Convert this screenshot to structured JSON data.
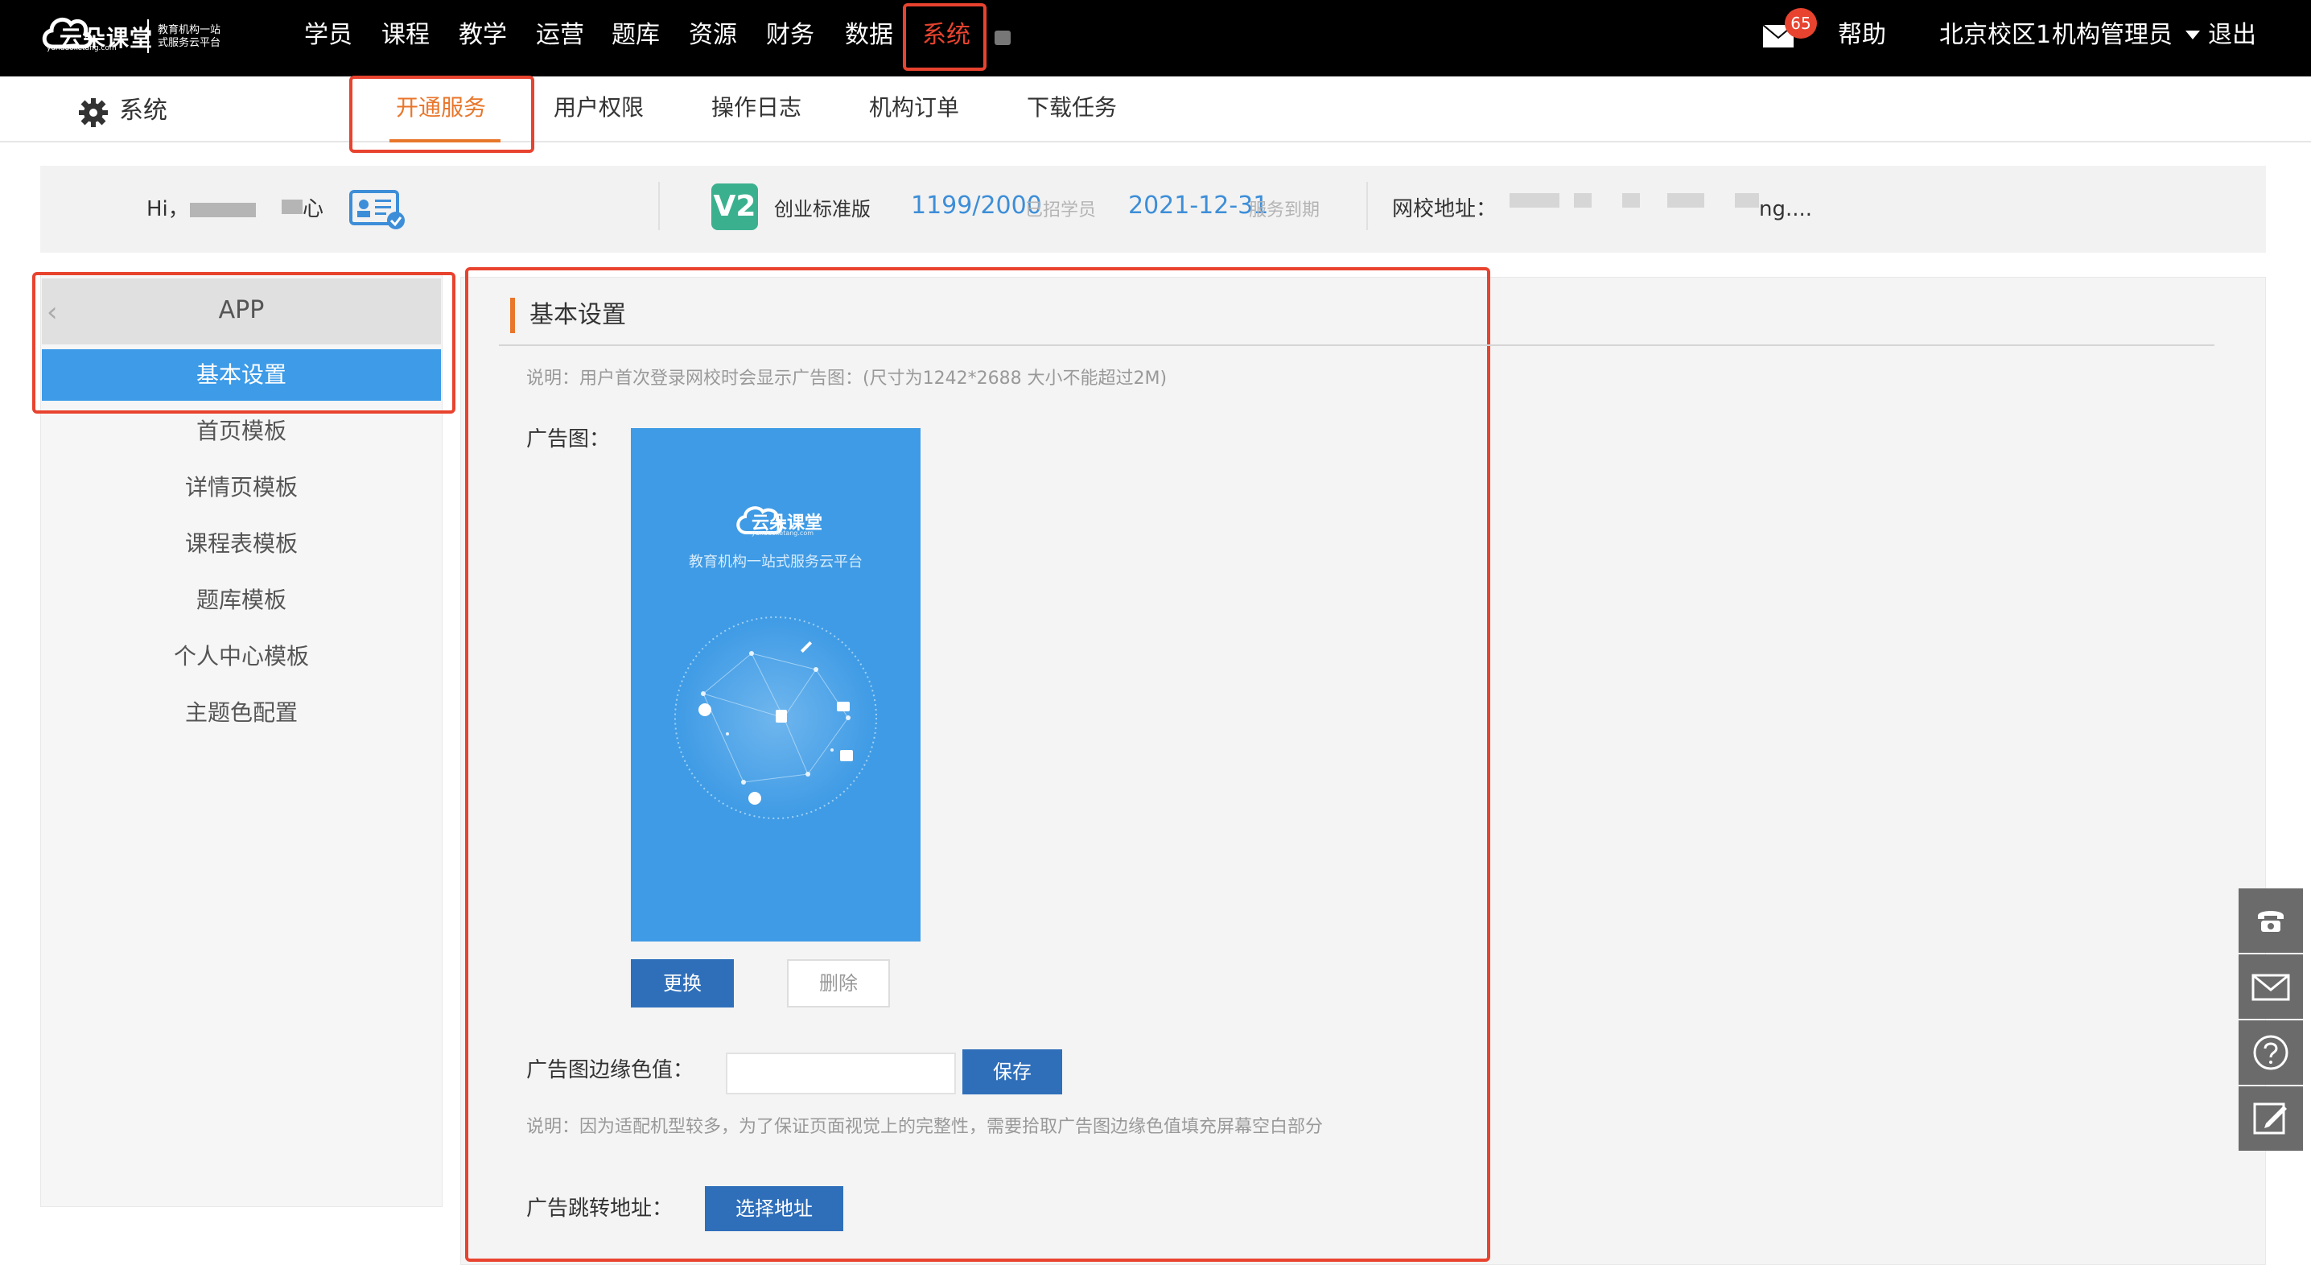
{
  "topbar": {
    "logo_text": "云朵课堂",
    "logo_sub": "yunduoketang.com",
    "logo_slogan": "教育机构一站式服务云平台",
    "nav": [
      "学员",
      "课程",
      "教学",
      "运营",
      "题库",
      "资源",
      "财务",
      "数据",
      "系统"
    ],
    "active_nav": "系统",
    "message_count": "65",
    "help": "帮助",
    "campus": "北京校区1",
    "role": "机构管理员",
    "logout": "退出"
  },
  "subnav": {
    "title": "系统",
    "tabs": [
      "开通服务",
      "用户权限",
      "操作日志",
      "机构订单",
      "下载任务"
    ],
    "active_tab": "开通服务"
  },
  "info": {
    "greeting_prefix": "Hi，",
    "greeting_suffix": "心",
    "edition": "创业标准版",
    "v2_logo": "V2",
    "students_used": "1199/2000",
    "students_label": "已招学员",
    "expire_date": "2021-12-31",
    "expire_label": "服务到期",
    "school_url_label": "网校地址：",
    "school_url_tail": "ng...."
  },
  "sidebar": {
    "header": "APP",
    "back_icon": "‹",
    "items": [
      "基本设置",
      "首页模板",
      "详情页模板",
      "课程表模板",
      "题库模板",
      "个人中心模板",
      "主题色配置"
    ],
    "active_item": "基本设置"
  },
  "main": {
    "section_title": "基本设置",
    "note1": "说明：用户首次登录网校时会显示广告图：(尺寸为1242*2688 大小不能超过2M)",
    "ad_label": "广告图：",
    "ad_image": {
      "brand": "云朵课堂",
      "brand_sub": "yunduoketang.com",
      "tagline": "教育机构一站式服务云平台"
    },
    "replace_button": "更换",
    "delete_button": "删除",
    "border_color_label": "广告图边缘色值：",
    "border_color_value": "",
    "save_button": "保存",
    "note2": "说明：因为适配机型较多，为了保证页面视觉上的完整性，需要拾取广告图边缘色值填充屏幕空白部分",
    "jump_label": "广告跳转地址：",
    "select_address_button": "选择地址"
  },
  "float_tools": [
    "phone-icon",
    "mail-icon",
    "help-icon",
    "edit-icon"
  ],
  "colors": {
    "accent_orange": "#e8762b",
    "highlight_red": "#e8432f",
    "primary_blue": "#2f6fba",
    "sidebar_active": "#3d9be8"
  }
}
